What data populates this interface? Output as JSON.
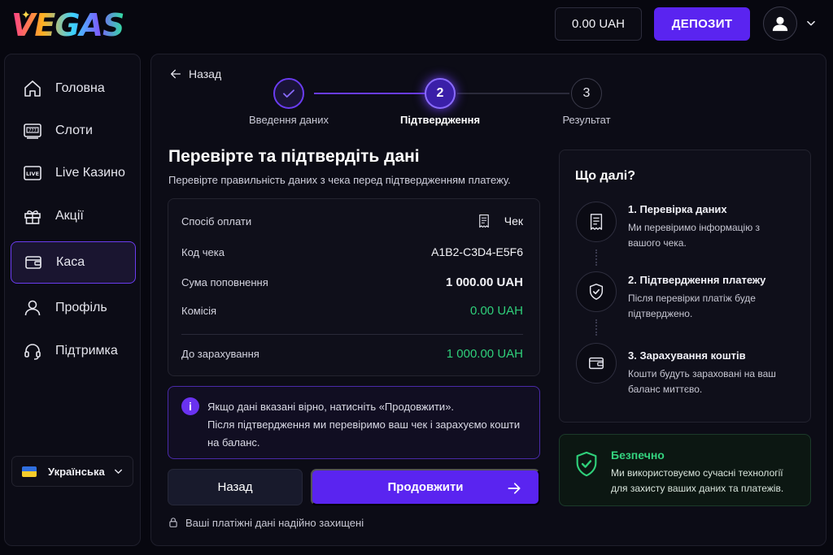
{
  "header": {
    "logo_text": "VEGAS",
    "balance": "0.00 UAH",
    "deposit_label": "ДЕПОЗИТ"
  },
  "sidebar": {
    "items": [
      {
        "label": "Головна",
        "icon": "home-icon"
      },
      {
        "label": "Слоти",
        "icon": "slot-machine-icon"
      },
      {
        "label": "Live Казино",
        "icon": "live-icon"
      },
      {
        "label": "Акції",
        "icon": "gift-icon"
      },
      {
        "label": "Каса",
        "icon": "wallet-icon",
        "active": true
      },
      {
        "label": "Профіль",
        "icon": "user-icon"
      },
      {
        "label": "Підтримка",
        "icon": "headset-icon"
      }
    ],
    "language": "Українська"
  },
  "main": {
    "back_label": "Назад",
    "steps": [
      {
        "label": "Введення даних",
        "state": "done",
        "number": "1"
      },
      {
        "label": "Підтвердження",
        "state": "current",
        "number": "2"
      },
      {
        "label": "Результат",
        "state": "pending",
        "number": "3"
      }
    ],
    "title": "Перевірте та підтвердіть дані",
    "subtitle": "Перевірте правильність даних з чека перед підтвердженням платежу.",
    "summary": {
      "method_label": "Спосіб оплати",
      "method_value": "Чек",
      "code_label": "Код чека",
      "code_value": "A1B2-C3D4-E5F6",
      "amount_label": "Сума поповнення",
      "amount_value": "1 000.00 UAH",
      "fee_label": "Комісія",
      "fee_value": "0.00 UAH",
      "credit_label": "До зарахування",
      "credit_value": "1 000.00 UAH"
    },
    "info": {
      "line1": "Якщо дані вказані вірно, натисніть «Продовжити».",
      "line2": "Після підтвердження ми перевіримо ваш чек і зарахуємо кошти на баланс."
    },
    "back_button": "Назад",
    "continue_button": "Продовжити",
    "secure_note": "Ваші платіжні дані надійно захищені"
  },
  "next_steps": {
    "title": "Що далі?",
    "items": [
      {
        "title": "1. Перевірка даних",
        "desc": "Ми перевіримо інформацію з вашого чека.",
        "icon": "document-icon"
      },
      {
        "title": "2. Підтвердження платежу",
        "desc": "Після перевірки платіж буде підтверджено.",
        "icon": "shield-check-icon"
      },
      {
        "title": "3. Зарахування коштів",
        "desc": "Кошти будуть зараховані на ваш баланс миттєво.",
        "icon": "wallet-icon"
      }
    ]
  },
  "safe": {
    "title": "Безпечно",
    "desc": "Ми використовуємо сучасні технології для захисту ваших даних та платежів."
  },
  "colors": {
    "accent": "#5a24f0",
    "success": "#2fcf7a",
    "background": "#07070f"
  }
}
